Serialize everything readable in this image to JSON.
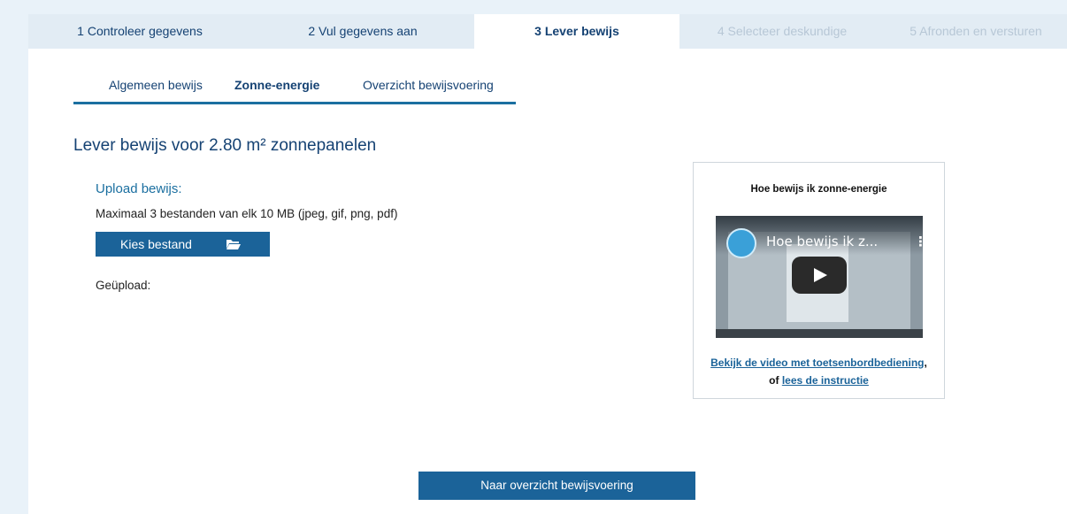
{
  "steps": [
    {
      "label": "1 Controleer gegevens"
    },
    {
      "label": "2 Vul gegevens aan"
    },
    {
      "label": "3 Lever bewijs"
    },
    {
      "label": "4 Selecteer deskundige"
    },
    {
      "label": "5 Afronden en versturen"
    }
  ],
  "active_step": "3 Lever bewijs",
  "subtabs": [
    {
      "label": "Algemeen bewijs"
    },
    {
      "label": "Zonne-energie"
    },
    {
      "label": "Overzicht bewijsvoering"
    }
  ],
  "active_subtab": "Zonne-energie",
  "heading": "Lever bewijs voor 2.80 m² zonnepanelen",
  "upload": {
    "label": "Upload bewijs:",
    "hint": "Maximaal 3 bestanden van elk 10 MB (jpeg, gif, png, pdf)",
    "button_label": "Kies bestand",
    "button_icon": "folder-open-icon",
    "uploaded_label": "Geüpload:"
  },
  "video": {
    "title": "Hoe bewijs ik zonne-energie",
    "player_title": "Hoe bewijs ik z...",
    "link_keyboard": "Bekijk de video met toetsenbordbediening",
    "comma": ",",
    "or_text": "of",
    "link_instruction": "lees de instructie"
  },
  "overview_button": "Naar overzicht bewijsvoering",
  "colors": {
    "brand": "#154273",
    "button": "#1b6399",
    "background": "#e9f2f9"
  }
}
